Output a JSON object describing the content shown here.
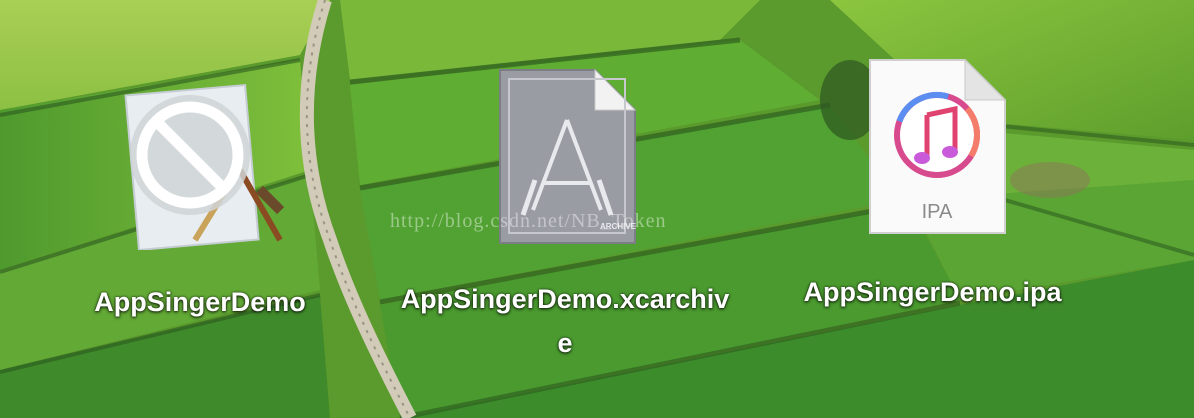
{
  "desktop": {
    "icons": [
      {
        "label": "AppSingerDemo",
        "type": "app",
        "icon": "app-prohibited-icon"
      },
      {
        "label": "AppSingerDemo.xcarchive",
        "type": "xcarchive",
        "icon": "xcarchive-icon",
        "badge_text": "ARCHIVE"
      },
      {
        "label": "AppSingerDemo.ipa",
        "type": "ipa",
        "icon": "ipa-icon",
        "badge_text": "IPA"
      }
    ],
    "watermark": "http://blog.csdn.net/NB_Token"
  },
  "colors": {
    "label_text": "#ffffff",
    "field_green": "#6aa832",
    "archive_gray": "#9a9ca4",
    "ipa_ring": "#d84a8e"
  }
}
